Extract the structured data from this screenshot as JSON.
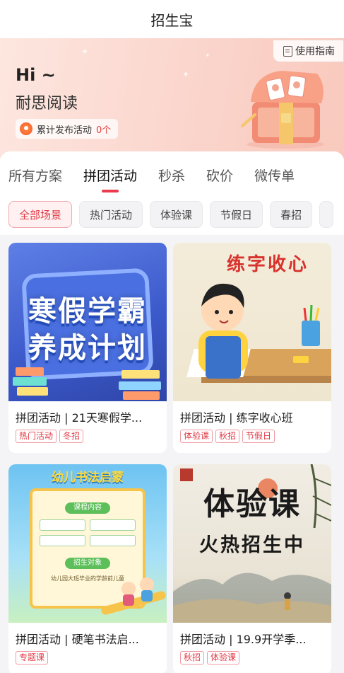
{
  "app": {
    "title": "招生宝"
  },
  "hero": {
    "guide_label": "使用指南",
    "greeting": "Hi ~",
    "username": "耐思阅读",
    "stat_label": "累计发布活动",
    "stat_count": "0个"
  },
  "tabs": [
    {
      "label": "所有方案",
      "active": false
    },
    {
      "label": "拼团活动",
      "active": true
    },
    {
      "label": "秒杀",
      "active": false
    },
    {
      "label": "砍价",
      "active": false
    },
    {
      "label": "微传单",
      "active": false
    }
  ],
  "chips": [
    {
      "label": "全部场景",
      "active": true
    },
    {
      "label": "热门活动",
      "active": false
    },
    {
      "label": "体验课",
      "active": false
    },
    {
      "label": "节假日",
      "active": false
    },
    {
      "label": "春招",
      "active": false
    }
  ],
  "cards": [
    {
      "title": "拼团活动 | 21天寒假学...",
      "tags": [
        "热门活动",
        "冬招"
      ],
      "image_text": [
        "寒假学霸",
        "养成计划"
      ]
    },
    {
      "title": "拼团活动 | 练字收心班",
      "tags": [
        "体验课",
        "秋招",
        "节假日"
      ],
      "image_text": [
        "练字收心"
      ]
    },
    {
      "title": "拼团活动 | 硬笔书法启...",
      "tags": [
        "专题课"
      ],
      "image_text": [
        "幼儿书法启蒙",
        "课程内容",
        "招生对象",
        "幼儿园大班毕业的学龄前儿童"
      ]
    },
    {
      "title": "拼团活动 | 19.9开学季...",
      "tags": [
        "秋招",
        "体验课"
      ],
      "image_text": [
        "体验课",
        "火热招生中"
      ]
    }
  ],
  "colors": {
    "accent": "#e93b4c",
    "tag": "#e03a46"
  }
}
